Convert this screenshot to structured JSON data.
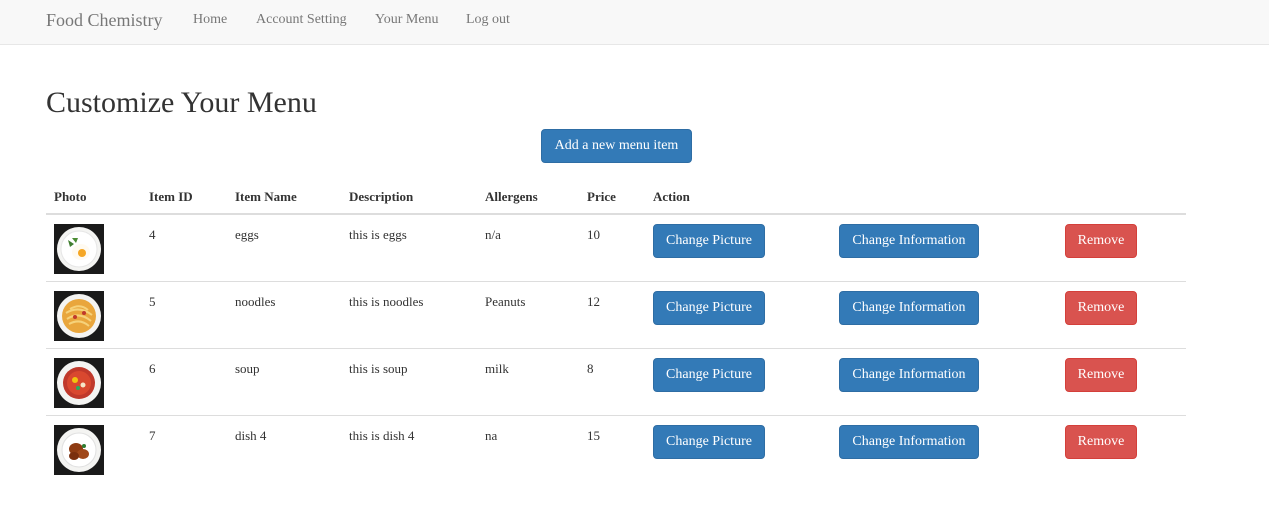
{
  "nav": {
    "brand": "Food Chemistry",
    "links": [
      "Home",
      "Account Setting",
      "Your Menu",
      "Log out"
    ]
  },
  "page_title": "Customize Your Menu",
  "add_button_label": "Add a new menu item",
  "table": {
    "headers": [
      "Photo",
      "Item ID",
      "Item Name",
      "Description",
      "Allergens",
      "Price",
      "Action"
    ],
    "rows": [
      {
        "id": "4",
        "name": "eggs",
        "description": "this is eggs",
        "allergens": "n/a",
        "price": "10",
        "photo": "fried-egg-plate"
      },
      {
        "id": "5",
        "name": "noodles",
        "description": "this is noodles",
        "allergens": "Peanuts",
        "price": "12",
        "photo": "noodles-plate"
      },
      {
        "id": "6",
        "name": "soup",
        "description": "this is soup",
        "allergens": "milk",
        "price": "8",
        "photo": "soup-plate"
      },
      {
        "id": "7",
        "name": "dish 4",
        "description": "this is dish 4",
        "allergens": "na",
        "price": "15",
        "photo": "meat-dish-plate"
      }
    ]
  },
  "actions": {
    "change_picture": "Change Picture",
    "change_information": "Change Information",
    "remove": "Remove"
  },
  "colors": {
    "primary": "#337ab7",
    "danger": "#d9534f",
    "navbar_bg": "#f8f8f8"
  }
}
